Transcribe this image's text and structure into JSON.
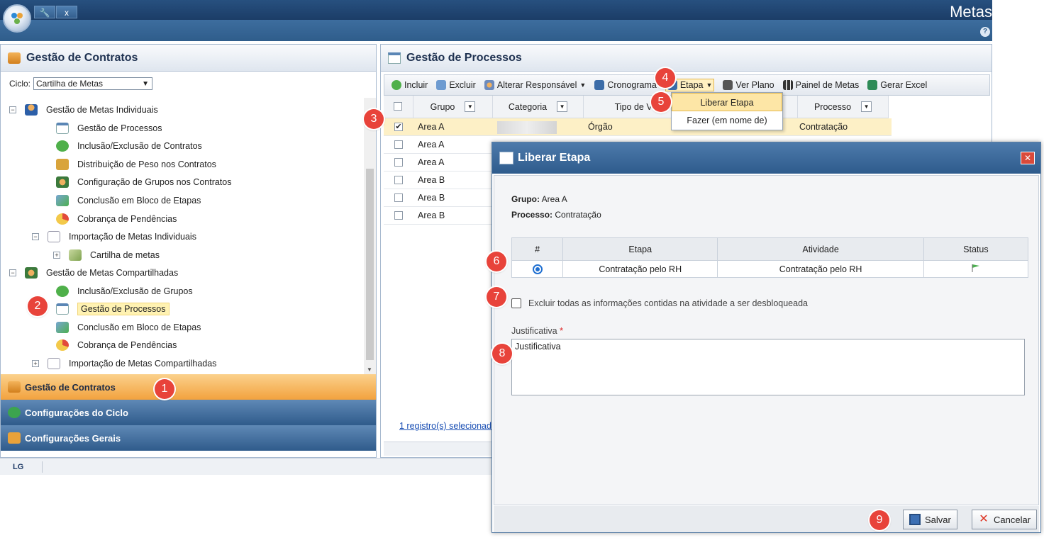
{
  "app": {
    "title": "Metas",
    "quick_access": [
      "🔧",
      "x"
    ]
  },
  "left_panel": {
    "title": "Gestão de Contratos",
    "ciclo_label": "Ciclo:",
    "ciclo_value": "Cartilha de Metas",
    "tree": [
      {
        "label": "Gestão de Metas Individuais",
        "toggle": "−"
      },
      {
        "label": "Gestão de Processos"
      },
      {
        "label": "Inclusão/Exclusão de Contratos"
      },
      {
        "label": "Distribuição de Peso nos Contratos"
      },
      {
        "label": "Configuração de Grupos nos Contratos"
      },
      {
        "label": "Conclusão em Bloco de Etapas"
      },
      {
        "label": "Cobrança de Pendências"
      },
      {
        "label": "Importação de Metas Individuais",
        "toggle": "−"
      },
      {
        "label": "Cartilha de metas",
        "toggle": "+"
      },
      {
        "label": "Gestão de Metas Compartilhadas",
        "toggle": "−"
      },
      {
        "label": "Inclusão/Exclusão de Grupos"
      },
      {
        "label": "Gestão de Processos"
      },
      {
        "label": "Conclusão em Bloco de Etapas"
      },
      {
        "label": "Cobrança de Pendências"
      },
      {
        "label": "Importação de Metas Compartilhadas",
        "toggle": "+"
      }
    ],
    "accordion": [
      "Gestão de Contratos",
      "Configurações do Ciclo",
      "Configurações Gerais"
    ]
  },
  "footer": {
    "logo": "LG"
  },
  "right_panel": {
    "title": "Gestão de Processos",
    "toolbar": [
      "Incluir",
      "Excluir",
      "Alterar Responsável",
      "Cronograma",
      "Etapa",
      "Ver Plano",
      "Painel de Metas",
      "Gerar Excel"
    ],
    "columns": [
      "Grupo",
      "Categoria",
      "Tipo de Vínc",
      "Processo"
    ],
    "rows": [
      {
        "grupo": "Area A",
        "tipo": "Órgão",
        "processo": "Contratação",
        "checked": "✔"
      },
      {
        "grupo": "Area A",
        "tipo": "",
        "processo": "",
        "checked": ""
      },
      {
        "grupo": "Area A",
        "tipo": "",
        "processo": "",
        "checked": ""
      },
      {
        "grupo": "Area B",
        "tipo": "",
        "processo": "",
        "checked": ""
      },
      {
        "grupo": "Area B",
        "tipo": "",
        "processo": "",
        "checked": ""
      },
      {
        "grupo": "Area B",
        "tipo": "",
        "processo": "",
        "checked": ""
      }
    ],
    "selection_link": "1 registro(s) selecionado",
    "menu": [
      "Liberar Etapa",
      "Fazer (em nome de)"
    ]
  },
  "dialog": {
    "title": "Liberar Etapa",
    "grupo_label": "Grupo:",
    "grupo_value": "Area A",
    "processo_label": "Processo:",
    "processo_value": "Contratação",
    "table_headers": [
      "#",
      "Etapa",
      "Atividade",
      "Status"
    ],
    "table_row": {
      "etapa": "Contratação pelo RH",
      "atividade": "Contratação pelo RH"
    },
    "exclude_label": "Excluir todas as informações contidas na atividade a ser desbloqueada",
    "justificativa_label": "Justificativa",
    "justificativa_required": "*",
    "justificativa_value": "Justificativa",
    "save_label": "Salvar",
    "cancel_label": "Cancelar"
  },
  "steps": [
    "1",
    "2",
    "3",
    "4",
    "5",
    "6",
    "7",
    "8",
    "9"
  ]
}
